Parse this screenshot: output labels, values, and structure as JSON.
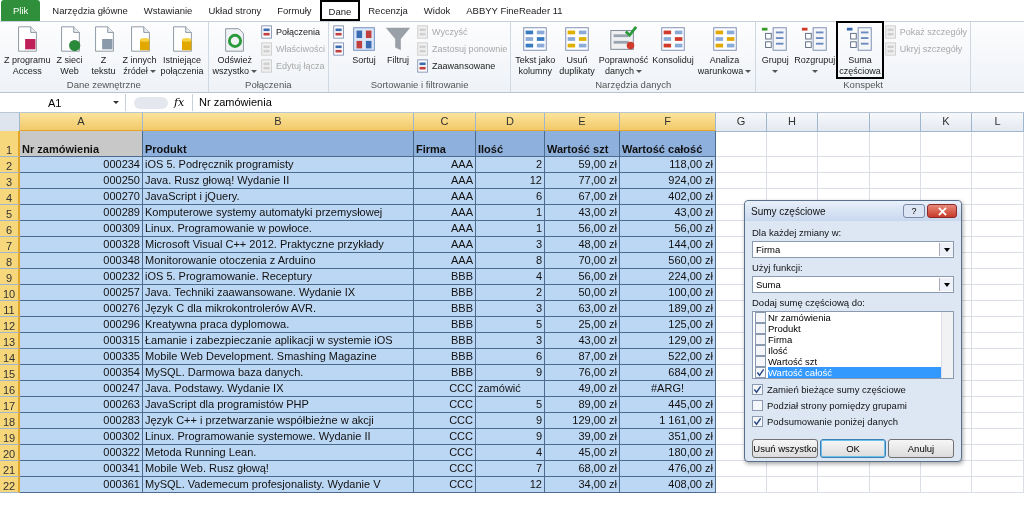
{
  "tabs": [
    {
      "label": "Plik",
      "kind": "file",
      "selected": false,
      "outlined": false
    },
    {
      "label": "Narzędzia główne",
      "kind": "tab",
      "selected": false,
      "outlined": false
    },
    {
      "label": "Wstawianie",
      "kind": "tab",
      "selected": false,
      "outlined": false
    },
    {
      "label": "Układ strony",
      "kind": "tab",
      "selected": false,
      "outlined": false
    },
    {
      "label": "Formuły",
      "kind": "tab",
      "selected": false,
      "outlined": false
    },
    {
      "label": "Dane",
      "kind": "tab",
      "selected": true,
      "outlined": true
    },
    {
      "label": "Recenzja",
      "kind": "tab",
      "selected": false,
      "outlined": false
    },
    {
      "label": "Widok",
      "kind": "tab",
      "selected": false,
      "outlined": false
    },
    {
      "label": "ABBYY FineReader 11",
      "kind": "tab",
      "selected": false,
      "outlined": false
    }
  ],
  "ribbon": {
    "groups": [
      {
        "label": "Dane zewnętrzne",
        "items": [
          {
            "kind": "large",
            "lines": [
              "Z programu",
              "Access"
            ],
            "dropdown": false,
            "outlined": false
          },
          {
            "kind": "large",
            "lines": [
              "Z sieci",
              "Web"
            ],
            "dropdown": false,
            "outlined": false
          },
          {
            "kind": "large",
            "lines": [
              "Z",
              "tekstu"
            ],
            "dropdown": false,
            "outlined": false
          },
          {
            "kind": "large",
            "lines": [
              "Z innych",
              "źródeł"
            ],
            "dropdown": true,
            "outlined": false
          },
          {
            "kind": "large",
            "lines": [
              "Istniejące",
              "połączenia"
            ],
            "dropdown": false,
            "outlined": false
          }
        ]
      },
      {
        "label": "Połączenia",
        "items": [
          {
            "kind": "large",
            "lines": [
              "Odśwież",
              "wszystko"
            ],
            "dropdown": true,
            "outlined": false
          },
          {
            "kind": "stack",
            "items": [
              {
                "label": "Połączenia",
                "disabled": false
              },
              {
                "label": "Właściwości",
                "disabled": true
              },
              {
                "label": "Edytuj łącza",
                "disabled": true
              }
            ]
          }
        ]
      },
      {
        "label": "Sortowanie i filtrowanie",
        "items": [
          {
            "kind": "stack",
            "items": [
              {
                "disabled": false
              },
              {
                "disabled": false
              }
            ]
          },
          {
            "kind": "large",
            "lines": [
              "Sortuj"
            ],
            "dropdown": false,
            "outlined": false
          },
          {
            "kind": "large",
            "lines": [
              "Filtruj"
            ],
            "dropdown": false,
            "outlined": false
          },
          {
            "kind": "stack",
            "items": [
              {
                "label": "Wyczyść",
                "disabled": true
              },
              {
                "label": "Zastosuj ponownie",
                "disabled": true
              },
              {
                "label": "Zaawansowane",
                "disabled": false
              }
            ]
          }
        ]
      },
      {
        "label": "Narzędzia danych",
        "items": [
          {
            "kind": "large",
            "lines": [
              "Tekst jako",
              "kolumny"
            ],
            "dropdown": false,
            "outlined": false
          },
          {
            "kind": "large",
            "lines": [
              "Usuń",
              "duplikaty"
            ],
            "dropdown": false,
            "outlined": false
          },
          {
            "kind": "large",
            "lines": [
              "Poprawność",
              "danych"
            ],
            "dropdown": true,
            "outlined": false
          },
          {
            "kind": "large",
            "lines": [
              "Konsoliduj"
            ],
            "dropdown": false,
            "outlined": false
          },
          {
            "kind": "large",
            "lines": [
              "Analiza",
              "warunkowa"
            ],
            "dropdown": true,
            "outlined": false
          }
        ]
      },
      {
        "label": "Konspekt",
        "items": [
          {
            "kind": "large",
            "lines": [
              "Grupuj"
            ],
            "dropdown": true,
            "outlined": false
          },
          {
            "kind": "large",
            "lines": [
              "Rozgrupuj"
            ],
            "dropdown": true,
            "outlined": false
          },
          {
            "kind": "large",
            "lines": [
              "Suma",
              "częściowa"
            ],
            "dropdown": false,
            "outlined": true
          },
          {
            "kind": "stack",
            "items": [
              {
                "label": "Pokaż szczegóły",
                "disabled": true
              },
              {
                "label": "Ukryj szczegóły",
                "disabled": true
              }
            ]
          }
        ]
      }
    ]
  },
  "formula_bar": {
    "name_box": "A1",
    "function_label": "fx",
    "value": "Nr zamówienia"
  },
  "columns": [
    {
      "letter": "A",
      "selected": true
    },
    {
      "letter": "B",
      "selected": true
    },
    {
      "letter": "C",
      "selected": true
    },
    {
      "letter": "D",
      "selected": true
    },
    {
      "letter": "E",
      "selected": true
    },
    {
      "letter": "F",
      "selected": true
    },
    {
      "letter": "G",
      "selected": false
    },
    {
      "letter": "H",
      "selected": false
    },
    {
      "selected": false
    },
    {
      "selected": false
    },
    {
      "letter": "K",
      "selected": false
    },
    {
      "letter": "L",
      "selected": false
    }
  ],
  "rows": [
    {
      "number": "1",
      "selected": true,
      "header": true,
      "cells": [
        {
          "text": "Nr zamówienia",
          "selected": true
        },
        {
          "text": "Produkt",
          "selected": false
        },
        {
          "text": "Firma",
          "selected": false
        },
        {
          "text": "Ilość",
          "selected": false
        },
        {
          "text": "Wartość szt",
          "selected": false
        },
        {
          "text": "Wartość całość",
          "selected": false
        }
      ]
    },
    {
      "number": "2",
      "selected": true,
      "cells": [
        "000234",
        "iOS 5. Podręcznik programisty",
        "AAA",
        "2",
        "59,00 zł",
        "118,00 zł"
      ]
    },
    {
      "number": "3",
      "selected": true,
      "cells": [
        "000250",
        "Java. Rusz głową! Wydanie II",
        "AAA",
        "12",
        "77,00 zł",
        "924,00 zł"
      ]
    },
    {
      "number": "4",
      "selected": true,
      "cells": [
        "000270",
        "JavaScript i jQuery.",
        "AAA",
        "6",
        "67,00 zł",
        "402,00 zł"
      ]
    },
    {
      "number": "5",
      "selected": true,
      "cells": [
        "000289",
        "Komputerowe systemy automatyki przemysłowej",
        "AAA",
        "1",
        "43,00 zł",
        "43,00 zł"
      ]
    },
    {
      "number": "6",
      "selected": true,
      "cells": [
        "000309",
        "Linux. Programowanie w powłoce.",
        "AAA",
        "1",
        "56,00 zł",
        "56,00 zł"
      ]
    },
    {
      "number": "7",
      "selected": true,
      "cells": [
        "000328",
        "Microsoft Visual C++ 2012. Praktyczne przykłady",
        "AAA",
        "3",
        "48,00 zł",
        "144,00 zł"
      ]
    },
    {
      "number": "8",
      "selected": true,
      "cells": [
        "000348",
        "Monitorowanie otoczenia z Arduino",
        "AAA",
        "8",
        "70,00 zł",
        "560,00 zł"
      ]
    },
    {
      "number": "9",
      "selected": true,
      "cells": [
        "000232",
        "iOS 5. Programowanie. Receptury",
        "BBB",
        "4",
        "56,00 zł",
        "224,00 zł"
      ]
    },
    {
      "number": "10",
      "selected": true,
      "cells": [
        "000257",
        "Java. Techniki zaawansowane. Wydanie IX",
        "BBB",
        "2",
        "50,00 zł",
        "100,00 zł"
      ]
    },
    {
      "number": "11",
      "selected": true,
      "cells": [
        "000276",
        "Język C dla mikrokontrolerów AVR.",
        "BBB",
        "3",
        "63,00 zł",
        "189,00 zł"
      ]
    },
    {
      "number": "12",
      "selected": true,
      "cells": [
        "000296",
        "Kreatywna praca dyplomowa.",
        "BBB",
        "5",
        "25,00 zł",
        "125,00 zł"
      ]
    },
    {
      "number": "13",
      "selected": true,
      "cells": [
        "000315",
        "Łamanie i zabezpieczanie aplikacji w systemie iOS",
        "BBB",
        "3",
        "43,00 zł",
        "129,00 zł"
      ]
    },
    {
      "number": "14",
      "selected": true,
      "cells": [
        "000335",
        "Mobile Web Development. Smashing Magazine",
        "BBB",
        "6",
        "87,00 zł",
        "522,00 zł"
      ]
    },
    {
      "number": "15",
      "selected": true,
      "cells": [
        "000354",
        "MySQL. Darmowa baza danych.",
        "BBB",
        "9",
        "76,00 zł",
        "684,00 zł"
      ]
    },
    {
      "number": "16",
      "selected": true,
      "cells": [
        "000247",
        "Java. Podstawy. Wydanie IX",
        "CCC",
        {
          "text": "zamówić",
          "kind": "text"
        },
        "49,00 zł",
        {
          "text": "#ARG!",
          "kind": "error"
        }
      ]
    },
    {
      "number": "17",
      "selected": true,
      "cells": [
        "000263",
        "JavaScript dla programistów PHP",
        "CCC",
        "5",
        "89,00 zł",
        "445,00 zł"
      ]
    },
    {
      "number": "18",
      "selected": true,
      "cells": [
        "000283",
        "Język C++ i przetwarzanie współbieżne w akcji",
        "CCC",
        "9",
        "129,00 zł",
        "1 161,00 zł"
      ]
    },
    {
      "number": "19",
      "selected": true,
      "cells": [
        "000302",
        "Linux. Programowanie systemowe. Wydanie II",
        "CCC",
        "9",
        "39,00 zł",
        "351,00 zł"
      ]
    },
    {
      "number": "20",
      "selected": true,
      "cells": [
        "000322",
        "Metoda Running Lean.",
        "CCC",
        "4",
        "45,00 zł",
        "180,00 zł"
      ]
    },
    {
      "number": "21",
      "selected": true,
      "cells": [
        "000341",
        "Mobile Web. Rusz głową!",
        "CCC",
        "7",
        "68,00 zł",
        "476,00 zł"
      ]
    },
    {
      "number": "22",
      "selected": true,
      "cells": [
        "000361",
        "MySQL. Vademecum profesjonalisty. Wydanie V",
        "CCC",
        "12",
        "34,00 zł",
        "408,00 zł"
      ]
    }
  ],
  "dialog": {
    "title": "Sumy częściowe",
    "help": "?",
    "change_label": "Dla każdej zmiany w:",
    "change_value": "Firma",
    "function_label": "Użyj funkcji:",
    "function_value": "Suma",
    "add_label": "Dodaj sumę częściową do:",
    "fields": [
      {
        "label": "Nr zamówienia",
        "checked": false,
        "selected": false
      },
      {
        "label": "Produkt",
        "checked": false,
        "selected": false
      },
      {
        "label": "Firma",
        "checked": false,
        "selected": false
      },
      {
        "label": "Ilość",
        "checked": false,
        "selected": false
      },
      {
        "label": "Wartość szt",
        "checked": false,
        "selected": false
      },
      {
        "label": "Wartość całość",
        "checked": true,
        "selected": true
      }
    ],
    "options": [
      {
        "label": "Zamień bieżące sumy częściowe",
        "checked": true
      },
      {
        "label": "Podział strony pomiędzy grupami",
        "checked": false
      },
      {
        "label": "Podsumowanie poniżej danych",
        "checked": true
      }
    ],
    "buttons": [
      {
        "label": "Usuń wszystko",
        "default": false
      },
      {
        "label": "OK",
        "default": true
      },
      {
        "label": "Anuluj",
        "default": false
      }
    ]
  }
}
